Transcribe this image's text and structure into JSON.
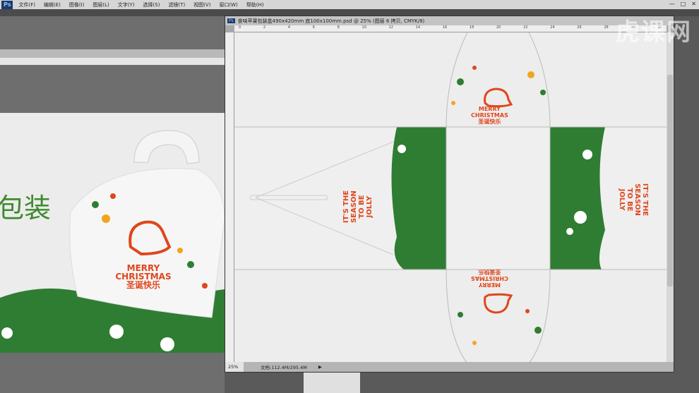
{
  "app": {
    "logo": "Ps"
  },
  "menu": [
    "文件(F)",
    "编辑(E)",
    "图像(I)",
    "图层(L)",
    "文字(Y)",
    "选择(S)",
    "滤镜(T)",
    "视图(V)",
    "窗口(W)",
    "帮助(H)"
  ],
  "window_controls": [
    "—",
    "□",
    "✕"
  ],
  "left_image": {
    "title": "包装",
    "brand": "MERRY CHRISTMAS",
    "chinese": "圣诞快乐"
  },
  "document": {
    "title": "食味苹果包装盒490x420mm 底100x100mm.psd @ 25% (图层 6 拷贝, CMYK/8)",
    "ruler_ticks": [
      "0",
      "2",
      "4",
      "6",
      "8",
      "10",
      "12",
      "14",
      "16",
      "18",
      "20",
      "22",
      "24",
      "26",
      "28",
      "30",
      "32"
    ],
    "artwork": {
      "line1": "MERRY",
      "line2": "CHRISTMAS",
      "chinese": "圣诞快乐",
      "slogan": [
        "IT'S THE",
        "SEASON",
        "TO BE",
        "JOLLY"
      ]
    },
    "status": {
      "zoom": "25%",
      "doc_size": "文档:112.4M/295.4M",
      "arrow": "▶"
    }
  },
  "watermark": "虎课网",
  "colors": {
    "green": "#2f7d32",
    "red": "#e0461b",
    "orange": "#f2a51c"
  }
}
